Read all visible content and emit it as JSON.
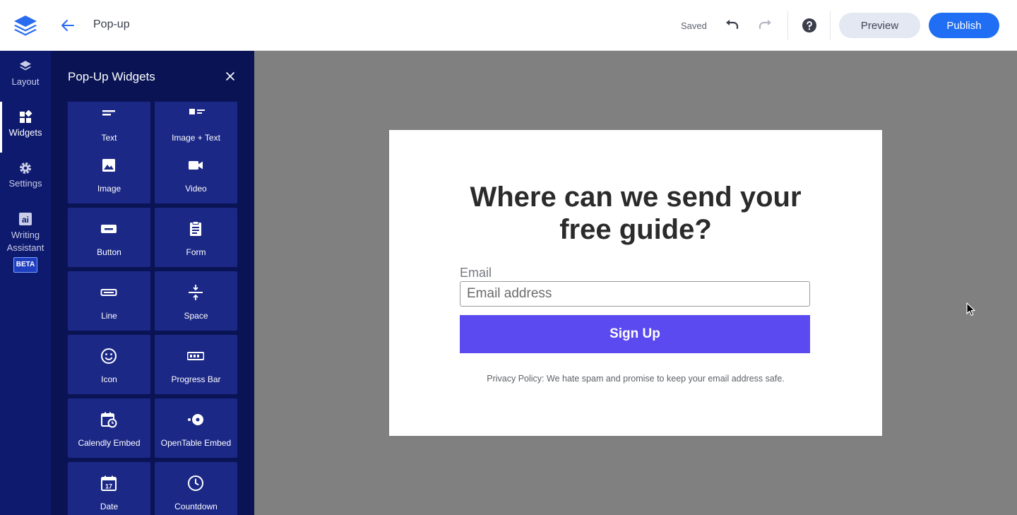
{
  "header": {
    "page_name": "Pop-up",
    "save_status": "Saved",
    "preview_label": "Preview",
    "publish_label": "Publish",
    "accent_color": "#1f6ef3"
  },
  "rail": {
    "items": [
      {
        "label": "Layout",
        "icon": "layers-icon"
      },
      {
        "label": "Widgets",
        "icon": "widgets-icon",
        "active": true
      },
      {
        "label": "Settings",
        "icon": "gear-icon"
      },
      {
        "label": "Writing Assistant",
        "line1": "Writing",
        "line2": "Assistant",
        "icon": "ai-icon",
        "badge": "BETA"
      }
    ]
  },
  "panel": {
    "title": "Pop-Up Widgets",
    "widgets": [
      {
        "label": "Text",
        "icon": "text-icon"
      },
      {
        "label": "Image + Text",
        "icon": "image-text-icon"
      },
      {
        "label": "Image",
        "icon": "image-icon"
      },
      {
        "label": "Video",
        "icon": "video-icon"
      },
      {
        "label": "Button",
        "icon": "button-icon"
      },
      {
        "label": "Form",
        "icon": "form-icon"
      },
      {
        "label": "Line",
        "icon": "line-icon"
      },
      {
        "label": "Space",
        "icon": "space-icon"
      },
      {
        "label": "Icon",
        "icon": "smiley-icon"
      },
      {
        "label": "Progress Bar",
        "icon": "progress-bar-icon"
      },
      {
        "label": "Calendly Embed",
        "icon": "calendly-icon"
      },
      {
        "label": "OpenTable Embed",
        "icon": "opentable-icon"
      },
      {
        "label": "Date",
        "icon": "calendar-date-icon",
        "icon_text": "17"
      },
      {
        "label": "Countdown",
        "icon": "clock-icon"
      }
    ]
  },
  "popup": {
    "headline_line1": "Where can we send your",
    "headline_line2": "free guide?",
    "email_label": "Email",
    "email_placeholder": "Email address",
    "email_value": "",
    "signup_label": "Sign Up",
    "signup_color": "#5a4af0",
    "privacy_text": "Privacy Policy: We hate spam and promise to keep your email address safe."
  }
}
